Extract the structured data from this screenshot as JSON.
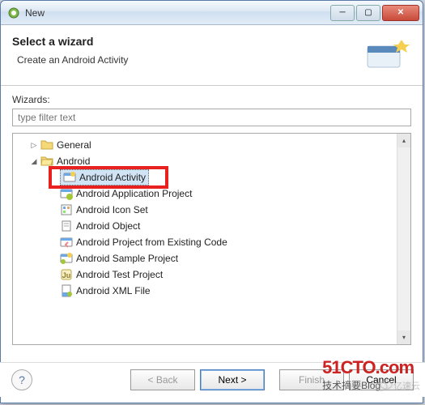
{
  "window": {
    "title": "New"
  },
  "header": {
    "title": "Select a wizard",
    "description": "Create an Android Activity"
  },
  "content": {
    "wizards_label": "Wizards:",
    "filter_placeholder": "type filter text"
  },
  "tree": {
    "nodes": [
      {
        "label": "General",
        "expanded": false,
        "level": 1
      },
      {
        "label": "Android",
        "expanded": true,
        "level": 1
      },
      {
        "label": "Android Activity",
        "level": 2,
        "selected": true
      },
      {
        "label": "Android Application Project",
        "level": 2
      },
      {
        "label": "Android Icon Set",
        "level": 2
      },
      {
        "label": "Android Object",
        "level": 2
      },
      {
        "label": "Android Project from Existing Code",
        "level": 2
      },
      {
        "label": "Android Sample Project",
        "level": 2
      },
      {
        "label": "Android Test Project",
        "level": 2
      },
      {
        "label": "Android XML File",
        "level": 2
      }
    ]
  },
  "buttons": {
    "help": "?",
    "back": "< Back",
    "next": "Next >",
    "finish": "Finish",
    "cancel": "Cancel"
  },
  "watermarks": {
    "w1_top": "51CTO.com",
    "w1_bot": "技术摘要Blog",
    "w2": "亿速云"
  }
}
